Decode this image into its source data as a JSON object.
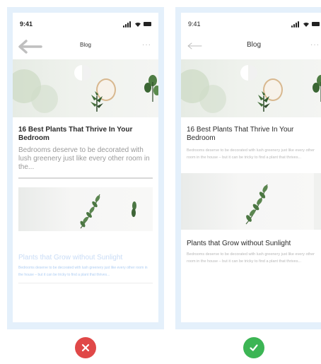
{
  "panels": {
    "bad": {
      "status_time": "9:41",
      "nav_title": "Blog",
      "nav_more": "···",
      "article1_title": "16 Best Plants That Thrive In Your Bedroom",
      "article1_excerpt": "Bedrooms deserve to be decorated with lush greenery just like every other room in the...",
      "article2_title": "Plants that Grow without Sunlight",
      "article2_excerpt": "Bedrooms deserve to be decorated with lush greenery just like every other room in the house – but it can be tricky to find a plant that thrives..."
    },
    "good": {
      "status_time": "9:41",
      "nav_title": "Blog",
      "nav_more": "···",
      "article1_title": "16 Best Plants That Thrive In Your Bedroom",
      "article1_excerpt": "Bedrooms deserve to be decorated with lush greenery just like every other room in the house – but it can be tricky to find a plant that thrives...",
      "article2_title": "Plants that Grow without Sunlight",
      "article2_excerpt": "Bedrooms deserve to be decorated with lush greenery just like every other room in the house – but it can be tricky to find a plant that thrives..."
    }
  },
  "verdicts": {
    "bad": {
      "icon": "cross-icon",
      "color": "#e04848"
    },
    "good": {
      "icon": "checkmark-icon",
      "color": "#3cb554"
    }
  },
  "colors": {
    "panel_background": "#e4f0fb",
    "faded_link_blue": "#aecdf2",
    "heavy_excerpt_gray": "#9a9a9a",
    "light_excerpt_gray": "#b8b8b8"
  }
}
